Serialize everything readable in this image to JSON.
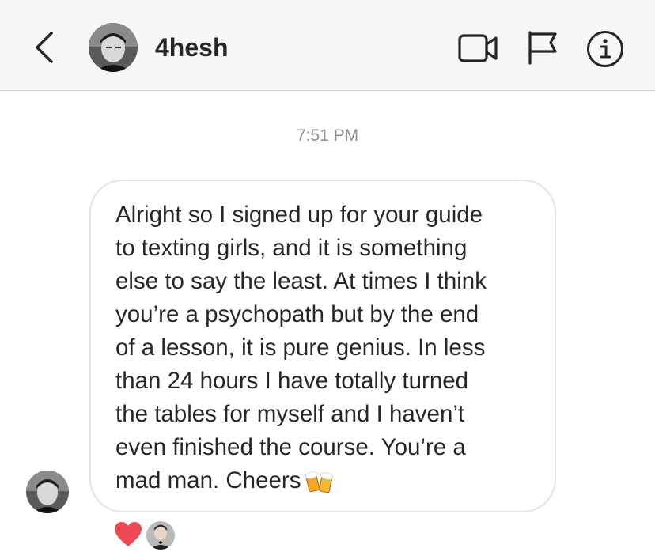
{
  "header": {
    "back_icon": "chevron-left-icon",
    "username": "4hesh",
    "video_icon": "video-camera-icon",
    "flag_icon": "flag-icon",
    "info_icon": "info-icon"
  },
  "thread": {
    "timestamp": "7:51 PM",
    "message": {
      "lines": [
        "Alright so I signed up for your guide",
        "to texting girls, and it is something",
        "else to say the least. At times I think",
        "you’re a psychopath but by the end",
        "of a lesson, it is pure genius. In less",
        "than 24 hours I have totally turned",
        "the tables for myself and I haven’t",
        "even finished the course. You’re a",
        "mad man. Cheers"
      ],
      "emoji": "beer-mugs-emoji"
    },
    "reactions": {
      "reaction_icon": "heart-icon",
      "reaction_color": "#ed4956"
    }
  }
}
